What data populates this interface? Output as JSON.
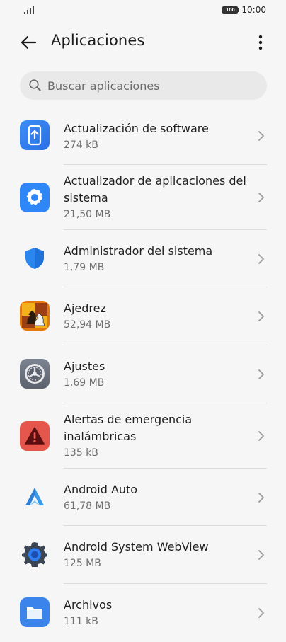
{
  "status_bar": {
    "battery": "100",
    "time": "10:00"
  },
  "header": {
    "title": "Aplicaciones",
    "back_icon": "arrow-left-icon",
    "menu_icon": "more-vertical-icon"
  },
  "search": {
    "placeholder": "Buscar aplicaciones",
    "icon": "search-icon"
  },
  "apps": [
    {
      "name": "Actualización de software",
      "size": "274 kB",
      "icon": "software-update-icon"
    },
    {
      "name": "Actualizador de aplicaciones del sistema",
      "size": "21,50 MB",
      "icon": "system-app-updater-icon"
    },
    {
      "name": "Administrador del sistema",
      "size": "1,79 MB",
      "icon": "shield-icon"
    },
    {
      "name": "Ajedrez",
      "size": "52,94 MB",
      "icon": "chess-icon"
    },
    {
      "name": "Ajustes",
      "size": "1,69 MB",
      "icon": "settings-icon"
    },
    {
      "name": "Alertas de emergencia inalámbricas",
      "size": "135 kB",
      "icon": "emergency-alert-icon"
    },
    {
      "name": "Android Auto",
      "size": "61,78 MB",
      "icon": "android-auto-icon"
    },
    {
      "name": "Android System WebView",
      "size": "125 MB",
      "icon": "webview-gear-icon"
    },
    {
      "name": "Archivos",
      "size": "111 kB",
      "icon": "folder-icon"
    }
  ],
  "colors": {
    "background": "#f6f6f6",
    "blue": "#2f80ed",
    "alert_red": "#e55850",
    "divider": "#dcdcdc"
  }
}
